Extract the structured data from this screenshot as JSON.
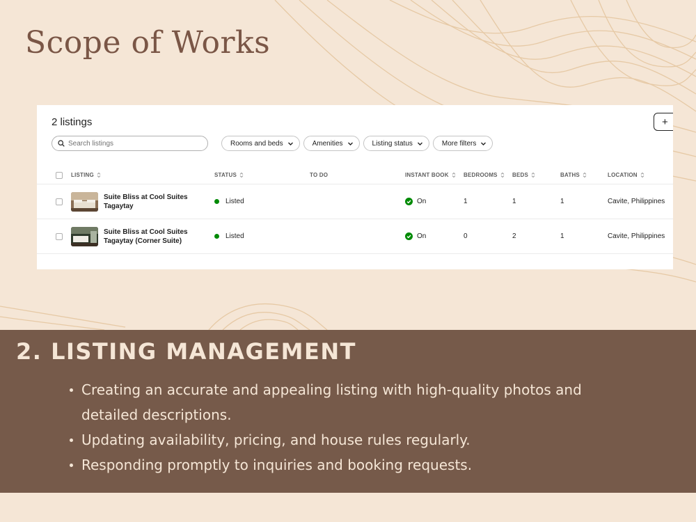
{
  "slide": {
    "title": "Scope of Works",
    "section_heading": "2. LISTING MANAGEMENT",
    "bullets": [
      "Creating an accurate and appealing listing with high-quality photos and detailed descriptions.",
      "Updating availability, pricing, and house rules regularly.",
      "Responding promptly to inquiries and booking requests."
    ],
    "colors": {
      "background": "#f5e6d6",
      "bar": "#765a4a",
      "title": "#7a5646",
      "status_green": "#008a05"
    }
  },
  "listings_panel": {
    "title": "2 listings",
    "add_button_label": "+",
    "search": {
      "placeholder": "Search listings",
      "value": ""
    },
    "filters": [
      "Rooms and beds",
      "Amenities",
      "Listing status",
      "More filters"
    ],
    "columns": [
      "LISTING",
      "STATUS",
      "TO DO",
      "INSTANT BOOK",
      "BEDROOMS",
      "BEDS",
      "BATHS",
      "LOCATION"
    ],
    "rows": [
      {
        "title": "Suite Bliss at Cool Suites Tagaytay",
        "status": "Listed",
        "todo": "",
        "instant_book": "On",
        "bedrooms": "1",
        "beds": "1",
        "baths": "1",
        "location": "Cavite, Philippines"
      },
      {
        "title": "Suite Bliss at Cool Suites Tagaytay (Corner Suite)",
        "status": "Listed",
        "todo": "",
        "instant_book": "On",
        "bedrooms": "0",
        "beds": "2",
        "baths": "1",
        "location": "Cavite, Philippines"
      }
    ]
  }
}
